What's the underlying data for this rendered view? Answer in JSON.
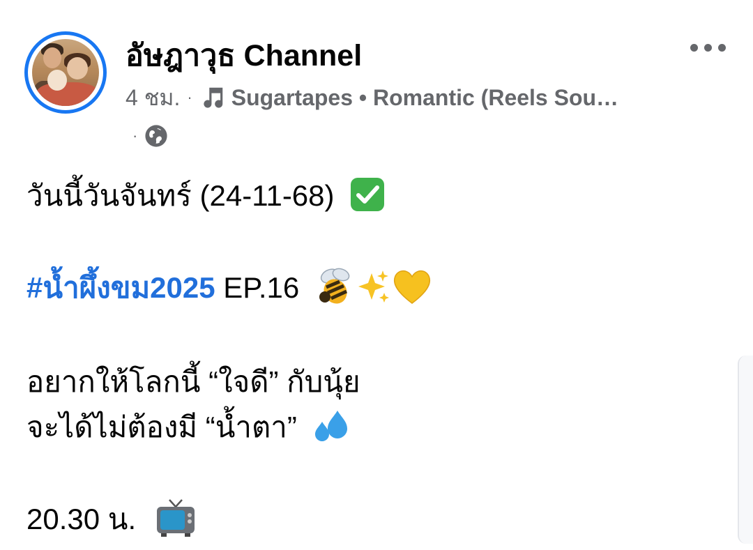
{
  "post": {
    "page_name": "อัษฎาวุธ Channel",
    "time": "4 ชม.",
    "separator": "·",
    "track": "Sugartapes • Romantic (Reels Sou…",
    "privacy_separator": "·",
    "icons": {
      "avatar": "profile-photo",
      "more": "more-options-icon",
      "music": "music-note-icon",
      "privacy": "globe-icon"
    },
    "accent_color": "#1877f2",
    "hashtag_color": "#216fdb"
  },
  "content": {
    "line1": "วันนี้วันจันทร์ (24-11-68)",
    "hashtag": "#น้ำผึ้งขม2025",
    "line2_rest": " EP.16",
    "line3": "อยากให้โลกนี้ “ใจดี” กับนุ้ย",
    "line4": "จะได้ไม่ต้องมี “น้ำตา”",
    "line5": "20.30 น.",
    "emoji": {
      "check": "check-mark-emoji",
      "bee": "bee-emoji",
      "sparkles": "sparkles-emoji",
      "heart": "yellow-heart-emoji",
      "droplets": "sweat-droplets-emoji",
      "tv": "television-emoji"
    }
  }
}
